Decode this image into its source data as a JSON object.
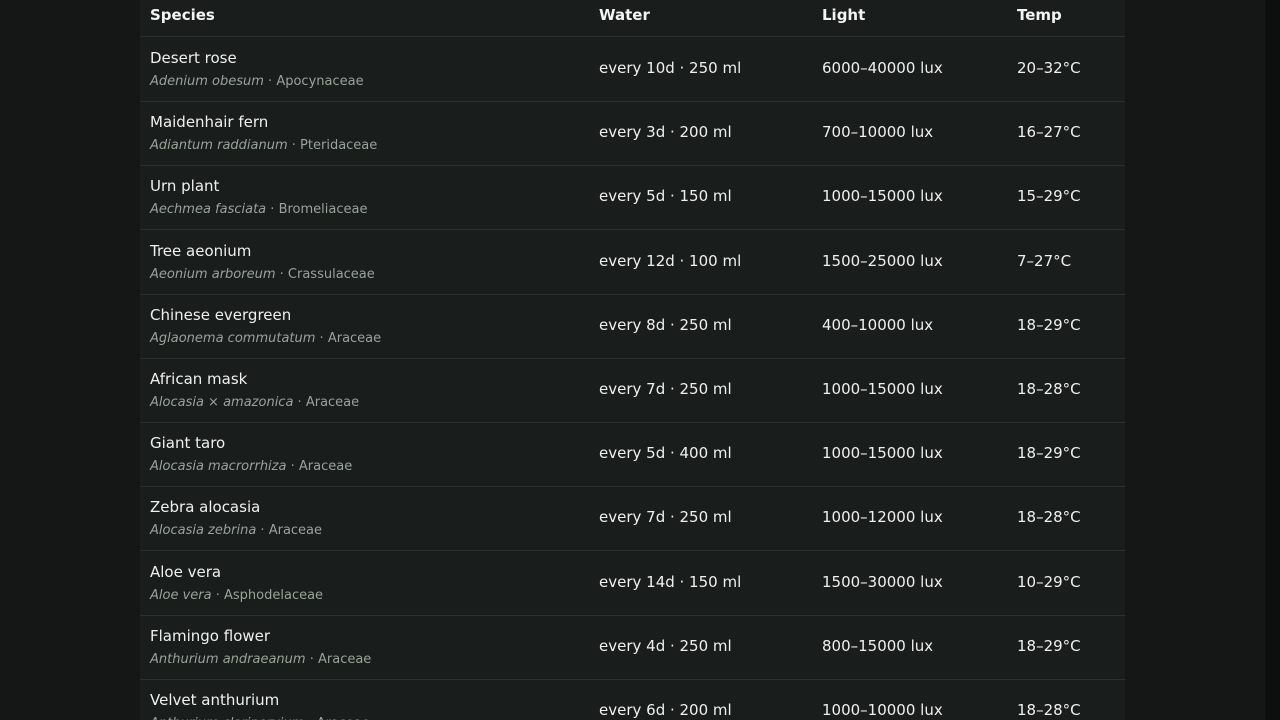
{
  "table": {
    "columns": {
      "species": "Species",
      "water": "Water",
      "light": "Light",
      "temp": "Temp"
    },
    "sub_separator": " · ",
    "rows": [
      {
        "common": "Desert rose",
        "scientific": "Adenium obesum",
        "family": "Apocynaceae",
        "water": "every 10d · 250 ml",
        "light": "6000–40000 lux",
        "temp": "20–32°C"
      },
      {
        "common": "Maidenhair fern",
        "scientific": "Adiantum raddianum",
        "family": "Pteridaceae",
        "water": "every 3d · 200 ml",
        "light": "700–10000 lux",
        "temp": "16–27°C"
      },
      {
        "common": "Urn plant",
        "scientific": "Aechmea fasciata",
        "family": "Bromeliaceae",
        "water": "every 5d · 150 ml",
        "light": "1000–15000 lux",
        "temp": "15–29°C"
      },
      {
        "common": "Tree aeonium",
        "scientific": "Aeonium arboreum",
        "family": "Crassulaceae",
        "water": "every 12d · 100 ml",
        "light": "1500–25000 lux",
        "temp": "7–27°C"
      },
      {
        "common": "Chinese evergreen",
        "scientific": "Aglaonema commutatum",
        "family": "Araceae",
        "water": "every 8d · 250 ml",
        "light": "400–10000 lux",
        "temp": "18–29°C"
      },
      {
        "common": "African mask",
        "scientific": "Alocasia × amazonica",
        "family": "Araceae",
        "water": "every 7d · 250 ml",
        "light": "1000–15000 lux",
        "temp": "18–28°C"
      },
      {
        "common": "Giant taro",
        "scientific": "Alocasia macrorrhiza",
        "family": "Araceae",
        "water": "every 5d · 400 ml",
        "light": "1000–15000 lux",
        "temp": "18–29°C"
      },
      {
        "common": "Zebra alocasia",
        "scientific": "Alocasia zebrina",
        "family": "Araceae",
        "water": "every 7d · 250 ml",
        "light": "1000–12000 lux",
        "temp": "18–28°C"
      },
      {
        "common": "Aloe vera",
        "scientific": "Aloe vera",
        "family": "Asphodelaceae",
        "water": "every 14d · 150 ml",
        "light": "1500–30000 lux",
        "temp": "10–29°C"
      },
      {
        "common": "Flamingo flower",
        "scientific": "Anthurium andraeanum",
        "family": "Araceae",
        "water": "every 4d · 250 ml",
        "light": "800–15000 lux",
        "temp": "18–29°C"
      },
      {
        "common": "Velvet anthurium",
        "scientific": "Anthurium clarinervium",
        "family": "Araceae",
        "water": "every 6d · 200 ml",
        "light": "1000–10000 lux",
        "temp": "18–28°C"
      }
    ]
  },
  "colors": {
    "page_background": "#141716",
    "table_background": "#191d1b",
    "row_divider": "#2b302d",
    "primary_text": "#eef1ee",
    "secondary_text": "#98a39b"
  }
}
